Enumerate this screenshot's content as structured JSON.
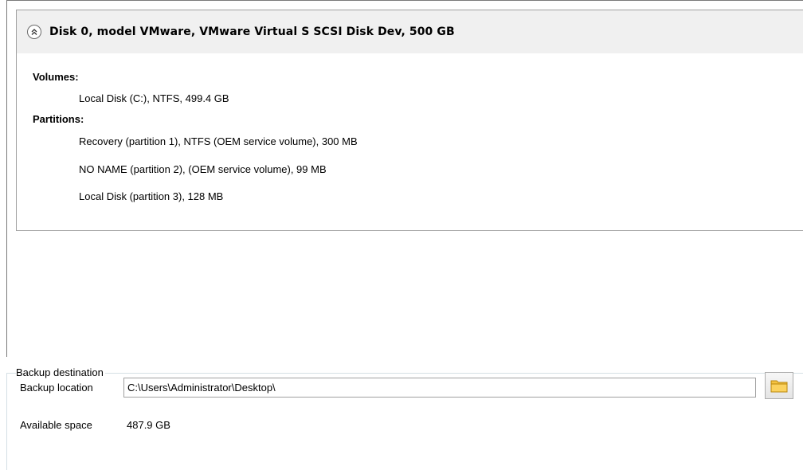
{
  "disk": {
    "title": "Disk 0, model VMware, VMware Virtual S SCSI Disk Dev, 500 GB",
    "volumes_heading": "Volumes:",
    "volumes": [
      "Local Disk (C:), NTFS, 499.4 GB"
    ],
    "partitions_heading": "Partitions:",
    "partitions": [
      "Recovery (partition 1), NTFS (OEM service volume), 300 MB",
      "NO NAME (partition 2), (OEM service volume), 99 MB",
      "Local Disk (partition 3), 128 MB"
    ],
    "collapse_icon": "double-chevron-up-icon"
  },
  "backup": {
    "group_label": "Backup destination",
    "location_label": "Backup location",
    "location_value": "C:\\Users\\Administrator\\Desktop\\",
    "browse_icon": "folder-icon",
    "space_label": "Available space",
    "space_value": "487.9 GB"
  },
  "colors": {
    "header_bg": "#f0f0f0",
    "border": "#a0a0a0",
    "folder": "#f5c342"
  }
}
